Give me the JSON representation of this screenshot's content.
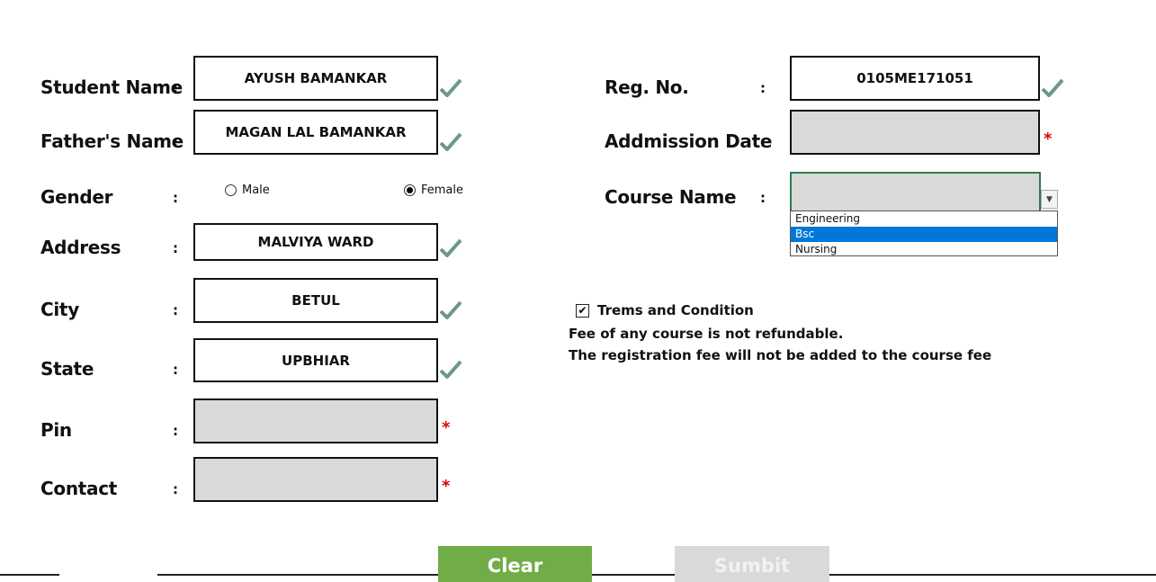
{
  "form": {
    "student_name": {
      "label": "Student Name",
      "value": "AYUSH BAMANKAR"
    },
    "father_name": {
      "label": "Father's Name",
      "value": "MAGAN LAL BAMANKAR"
    },
    "gender": {
      "label": "Gender",
      "options": [
        "Male",
        "Female"
      ],
      "selected": "Female"
    },
    "address": {
      "label": "Address",
      "value": "MALVIYA WARD"
    },
    "city": {
      "label": "City",
      "value": "BETUL"
    },
    "state": {
      "label": "State",
      "value": "UPBHIAR"
    },
    "pin": {
      "label": "Pin",
      "value": ""
    },
    "contact": {
      "label": "Contact",
      "value": ""
    },
    "reg_no": {
      "label": "Reg. No.",
      "value": "0105ME171051"
    },
    "admission_date": {
      "label": "Addmission Date",
      "value": ""
    },
    "course_name": {
      "label": "Course Name",
      "value": "",
      "options": [
        "Engineering",
        "Bsc",
        "Nursing"
      ],
      "highlighted": "Bsc"
    },
    "colon": ":",
    "required_mark": "*"
  },
  "terms": {
    "checkbox_label": "Trems and Condition",
    "checked": true,
    "lines": [
      "Fee of any course is not refundable.",
      "The registration fee will not be added to the course fee"
    ]
  },
  "buttons": {
    "clear": "Clear",
    "submit": "Sumbit"
  },
  "icons": {
    "valid": "checkmark-icon",
    "dropdown": "chevron-down-icon",
    "checkbox": "check-icon"
  },
  "colors": {
    "valid_check": "#6a9a86",
    "required": "#e00000",
    "clear_button": "#70ad47",
    "submit_button": "#d9d9d9",
    "empty_field": "#d9d9d9",
    "selected_option": "#0078d7"
  }
}
